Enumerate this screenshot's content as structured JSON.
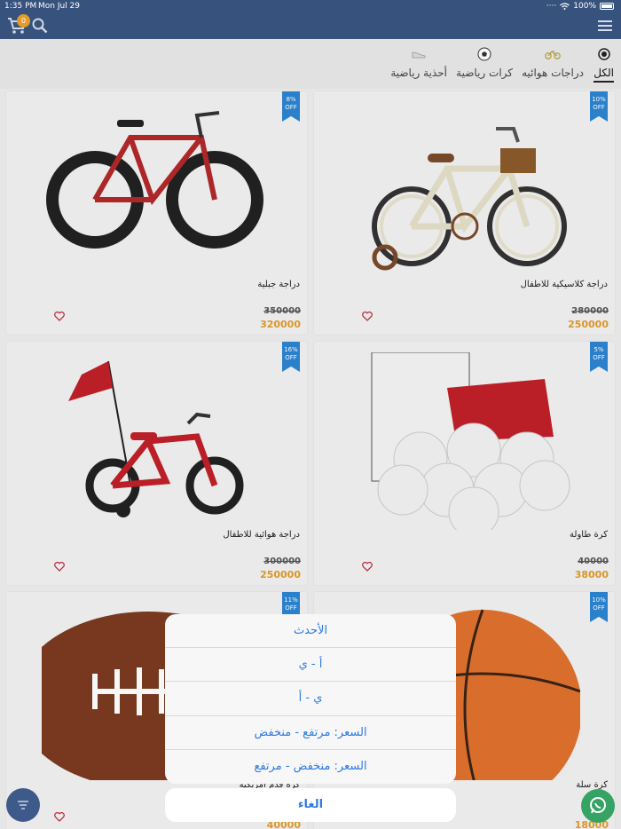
{
  "status_bar": {
    "time": "1:35 PM",
    "date": "Mon Jul 29",
    "battery": "100%"
  },
  "header": {
    "cart_count": "0"
  },
  "tabs": [
    {
      "label": "الكل",
      "icon": "target-icon"
    },
    {
      "label": "دراجات هوائيه",
      "icon": "bicycle-icon"
    },
    {
      "label": "كرات رياضية",
      "icon": "soccer-ball-icon"
    },
    {
      "label": "أحذية رياضية",
      "icon": "shoe-icon"
    }
  ],
  "products": [
    {
      "name": "دراجة كلاسيكية للاطفال",
      "discount": "10%",
      "off": "OFF",
      "old_price": "280000",
      "price": "250000"
    },
    {
      "name": "دراجة جبلية",
      "discount": "8%",
      "off": "OFF",
      "old_price": "350000",
      "price": "320000"
    },
    {
      "name": "كرة طاولة",
      "discount": "5%",
      "off": "OFF",
      "old_price": "40000",
      "price": "38000"
    },
    {
      "name": "دراجة هوائية للاطفال",
      "discount": "16%",
      "off": "OFF",
      "old_price": "300000",
      "price": "250000"
    },
    {
      "name": "كرة سلة",
      "discount": "10%",
      "off": "OFF",
      "old_price": "",
      "price": "18000"
    },
    {
      "name": "كرة قدم امريكية",
      "discount": "11%",
      "off": "OFF",
      "old_price": "",
      "price": "40000"
    }
  ],
  "sort_sheet": {
    "options": [
      "الأحدث",
      "أ - ي",
      "ي - أ",
      "السعر: مرتفع - منخفض",
      "السعر: منخفض - مرتفع"
    ],
    "cancel": "الغاء"
  },
  "colors": {
    "header": "#37527c",
    "accent": "#e39b2a",
    "ribbon": "#2c85d1",
    "link": "#2d7be3"
  }
}
